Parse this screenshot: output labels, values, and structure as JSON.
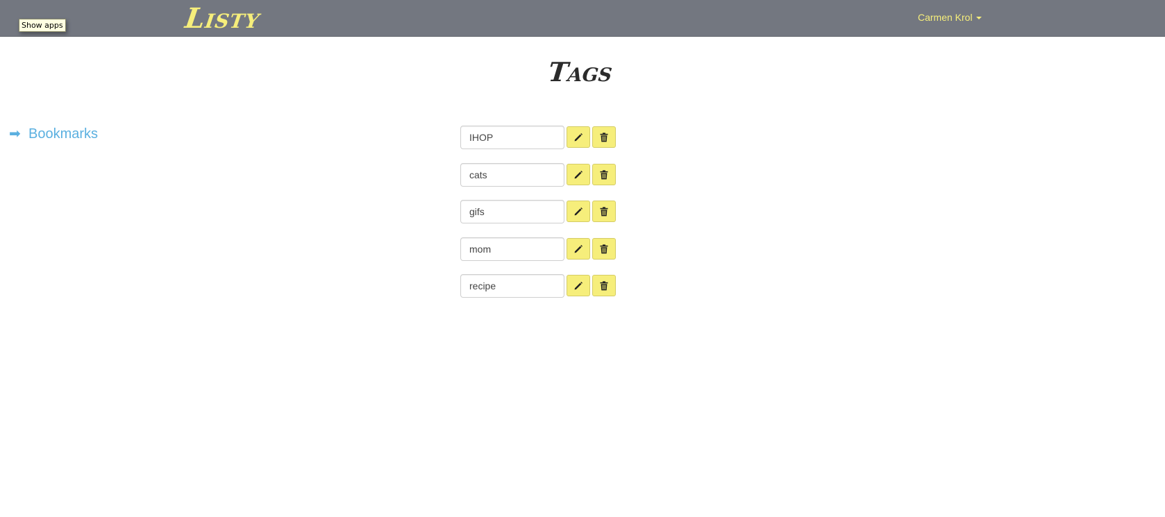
{
  "tooltip": {
    "text": "Show apps"
  },
  "navbar": {
    "brand": "Listy",
    "user_name": "Carmen Krol"
  },
  "page": {
    "title": "Tags"
  },
  "sidebar": {
    "link_label": "Bookmarks",
    "link_icon": "arrow-right-icon"
  },
  "tags": [
    {
      "value": "IHOP"
    },
    {
      "value": "cats"
    },
    {
      "value": "gifs"
    },
    {
      "value": "mom"
    },
    {
      "value": "recipe"
    }
  ],
  "icons": {
    "edit": "pencil-icon",
    "delete": "trash-icon"
  },
  "colors": {
    "navbar_bg": "#737780",
    "accent_yellow": "#f6ee7b",
    "link_blue": "#5bb0e0",
    "title_dark": "#2b2b2b"
  }
}
